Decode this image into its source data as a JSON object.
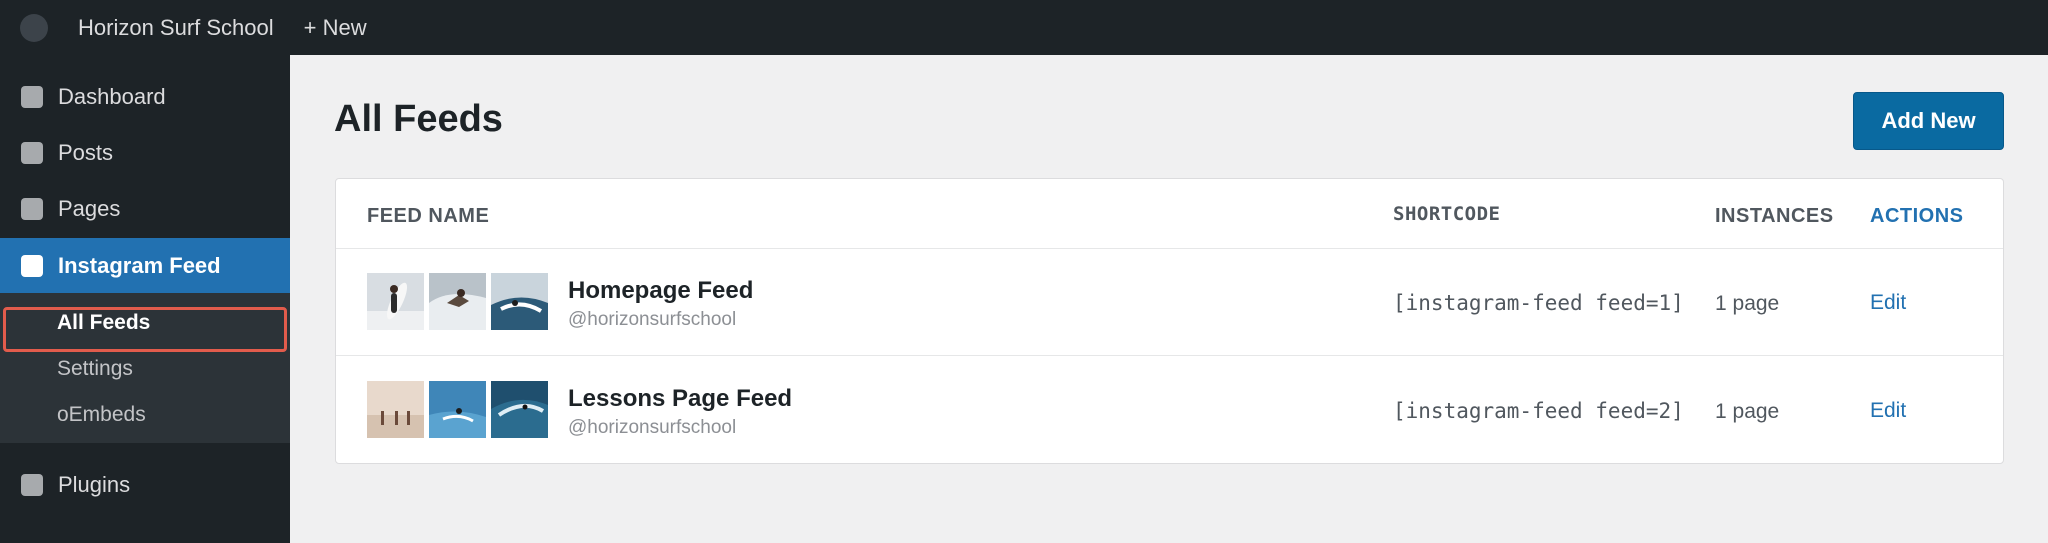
{
  "topbar": {
    "site_name": "Horizon Surf School",
    "new_label": "+ New"
  },
  "sidebar": {
    "items": [
      {
        "label": "Dashboard",
        "icon": "dashboard-icon"
      },
      {
        "label": "Posts",
        "icon": "posts-icon"
      },
      {
        "label": "Pages",
        "icon": "pages-icon"
      },
      {
        "label": "Instagram Feed",
        "icon": "instagram-icon",
        "active": true
      },
      {
        "label": "Plugins",
        "icon": "plugins-icon"
      }
    ],
    "submenu": [
      {
        "label": "All Feeds",
        "current": true
      },
      {
        "label": "Settings"
      },
      {
        "label": "oEmbeds"
      }
    ]
  },
  "main": {
    "title": "All Feeds",
    "add_new_label": "Add New",
    "columns": {
      "feed_name": "FEED NAME",
      "shortcode": "SHORTCODE",
      "instances": "INSTANCES",
      "actions": "ACTIONS"
    },
    "feeds": [
      {
        "name": "Homepage Feed",
        "handle": "@horizonsurfschool",
        "shortcode": "[instagram-feed feed=1]",
        "instances": "1 page",
        "action": "Edit"
      },
      {
        "name": "Lessons Page Feed",
        "handle": "@horizonsurfschool",
        "shortcode": "[instagram-feed feed=2]",
        "instances": "1 page",
        "action": "Edit"
      }
    ]
  },
  "colors": {
    "admin_bar": "#1d2327",
    "accent": "#2271b1",
    "button": "#0a6aa1",
    "highlight": "#e25c4c"
  }
}
